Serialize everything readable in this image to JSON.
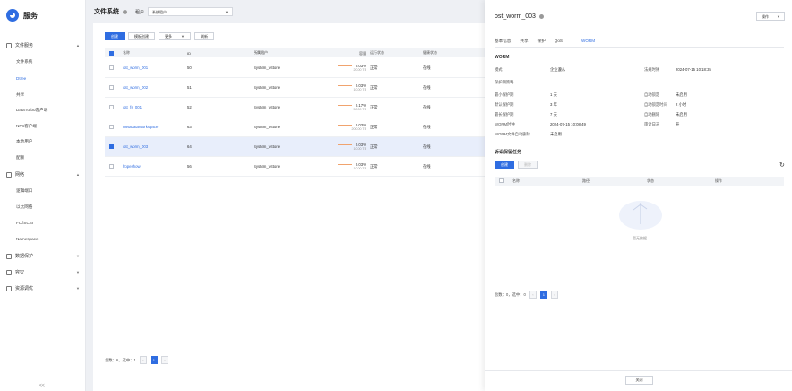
{
  "app": {
    "name": "服务"
  },
  "sidebar": {
    "groups": [
      {
        "label": "文件服务",
        "items": [
          "文件系统",
          "Dtree",
          "共享",
          "DataTurbo客户端",
          "NFS客户端",
          "本地用户",
          "配额"
        ]
      },
      {
        "label": "网络",
        "items": [
          "逻辑端口",
          "以太网络",
          "FC/iSCSI",
          "Namespace"
        ]
      },
      {
        "label": "数据保护",
        "items": []
      },
      {
        "label": "容灾",
        "items": []
      },
      {
        "label": "资源调优",
        "items": []
      }
    ],
    "active_item": "Dtree",
    "collapse": "<<"
  },
  "header": {
    "title": "文件系统",
    "tenant_label": "租户",
    "tenant_value": "系统租户"
  },
  "toolbar": {
    "create": "创建",
    "bulk_create": "模板创建",
    "more": "更多",
    "refresh_btn": "刷新"
  },
  "table": {
    "columns": [
      "名称",
      "ID",
      "所属租户",
      "容量",
      "运行状态",
      "健康状态"
    ],
    "rows": [
      {
        "name": "ost_worm_001",
        "id": "50",
        "owner": "System_vStore",
        "cap_pct": "0.03%",
        "cap_sub": "20.00 TB",
        "run": "正常",
        "health": "在线",
        "selected": false
      },
      {
        "name": "ost_worm_002",
        "id": "51",
        "owner": "System_vStore",
        "cap_pct": "0.03%",
        "cap_sub": "10.00 TB",
        "run": "正常",
        "health": "在线",
        "selected": false
      },
      {
        "name": "ost_fs_001",
        "id": "52",
        "owner": "System_vStore",
        "cap_pct": "0.17%",
        "cap_sub": "50.00 TB",
        "run": "正常",
        "health": "在线",
        "selected": false
      },
      {
        "name": "metadataWorkspace",
        "id": "63",
        "owner": "System_vStore",
        "cap_pct": "0.03%",
        "cap_sub": "200.00 TB",
        "run": "正常",
        "health": "在线",
        "selected": false
      },
      {
        "name": "ost_worm_003",
        "id": "64",
        "owner": "System_vStore",
        "cap_pct": "0.03%",
        "cap_sub": "10.00 TB",
        "run": "正常",
        "health": "在线",
        "selected": true
      },
      {
        "name": "hopeshow",
        "id": "56",
        "owner": "System_vStore",
        "cap_pct": "0.03%",
        "cap_sub": "10.00 TB",
        "run": "正常",
        "health": "在线",
        "selected": false
      }
    ]
  },
  "pager": {
    "summary": "总数：6，选中：1",
    "page": "1"
  },
  "drawer": {
    "title": "ost_worm_003",
    "op_button": "操作",
    "tabs": [
      "基本信息",
      "共享",
      "保护",
      "QoS",
      "WORM"
    ],
    "active_tab": "WORM",
    "worm_section": "WORM",
    "fields_left": [
      {
        "k": "模式",
        "v": "企业遵从"
      },
      {
        "k": "保护期策略",
        "v": ""
      },
      {
        "k": "最小保护期",
        "v": "1 天"
      },
      {
        "k": "默认保护期",
        "v": "3 年"
      },
      {
        "k": "最长保护期",
        "v": "7 天"
      },
      {
        "k": "WORM时钟",
        "v": "2024-07-15 10:08:49"
      },
      {
        "k": "WORM文件自动删除",
        "v": "未启用"
      }
    ],
    "fields_right": [
      {
        "k": "法规时钟",
        "v": "2024-07-15 10:18:35"
      },
      {
        "k": "自动锁定",
        "v": "未启用"
      },
      {
        "k": "自动锁定时间",
        "v": "2 小时"
      },
      {
        "k": "自动删除",
        "v": "未启用"
      },
      {
        "k": "审计日志",
        "v": "开"
      }
    ],
    "task_section": "诉讼保留任务",
    "task_create": "创建",
    "task_delete": "删除",
    "task_columns": [
      "名称",
      "路径",
      "状态",
      "操作"
    ],
    "empty_label": "暂无数据",
    "pager_summary": "总数：0，选中：0",
    "pager_page": "1",
    "close": "关闭"
  }
}
